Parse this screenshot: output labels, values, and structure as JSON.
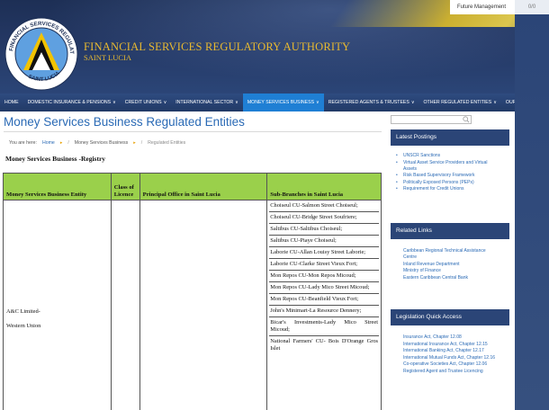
{
  "topbar": {
    "link_label": "Future Management",
    "right_label": "0/0"
  },
  "org": {
    "title": "FINANCIAL SERVICES  REGULATORY AUTHORITY",
    "subtitle": "SAINT LUCIA",
    "logo_top": "FINANCIAL SERVICES REGULATORY",
    "logo_bottom": "SAINT LUCIA"
  },
  "nav": {
    "items": [
      {
        "label": "HOME",
        "chevron": false,
        "active": false
      },
      {
        "label": "DOMESTIC INSURANCE & PENSIONS",
        "chevron": true,
        "active": false
      },
      {
        "label": "CREDIT UNIONS",
        "chevron": true,
        "active": false
      },
      {
        "label": "INTERNATIONAL SECTOR",
        "chevron": true,
        "active": false
      },
      {
        "label": "MONEY SERVICES BUSINESS",
        "chevron": true,
        "active": true
      },
      {
        "label": "REGISTERED AGENTS & TRUSTEES",
        "chevron": true,
        "active": false
      },
      {
        "label": "OTHER REGULATED ENTITIES",
        "chevron": true,
        "active": false
      },
      {
        "label": "OUR MEDIA",
        "chevron": true,
        "active": false
      }
    ],
    "chevron_glyph": "∨"
  },
  "page": {
    "title": "Money Services Business Regulated Entities",
    "breadcrumb": {
      "prefix": "You are here:",
      "home": "Home",
      "parent": "Money Services Business",
      "current": "Regulated Entities"
    },
    "section_heading": "Money Services Business -Registry"
  },
  "table": {
    "headers": {
      "entity": "Money Services Business Entity",
      "class": "Class of Licence",
      "office": "Principal Office in Saint Lucia",
      "branches": "Sub-Branches in Saint Lucia"
    },
    "entity_name": "A&C Limited-",
    "entity_name2": "Western Union",
    "branches": [
      "Choiseul CU-Salmon Street Choiseul;",
      "Choiseul CU-Bridge Street Soufriere;",
      "Saltibus CU-Saltibus Choiseul;",
      "Saltibus CU-Piaye Choiseul;",
      "Laborie CU-Allan Louisy Street Laborie;",
      "Laborie CU-Clarke Street Vieux Fort;",
      "Mon Repos CU-Mon Repos Micoud;",
      "Mon Repos CU-Lady Mico Street Micoud;",
      "Mon Repos CU-Beanfield Vieux Fort;",
      "John's Minimart-La Resource Dennery;",
      "Bicar's Investments-Lady Mico Street Micoud;",
      "National Farmers' CU- Bois D'Orange Gros Islet"
    ]
  },
  "sidebar": {
    "latest_title": "Latest Postings",
    "latest_items": [
      "UNSCR Sanctions",
      "Virtual Asset Service Providers and Virtual Assets",
      "Risk Based Supervisory Framework",
      "Politically Exposed Persons (PEPs)",
      "Requirement for Credit Unions"
    ],
    "related_title": "Related Links",
    "related_items": [
      "Caribbean Regional Technical Assistance Centre",
      "Inland Revenue Department",
      "Ministry of Finance",
      "Eastern Caribbean Central Bank"
    ],
    "legislation_title": "Legislation Quick Access",
    "legislation_items": [
      "Insurance Act, Chapter 12.08",
      "International Insurance Act, Chapter 12.15",
      "International Banking Act, Chapter 12.17",
      "International Mutual Funds Act, Chapter 12.16",
      "Co-operative Societies Act, Chapter 12.06",
      "Registered Agent and Trustee Licencing"
    ]
  },
  "colors": {
    "brand_navy": "#243864",
    "accent_gold": "#e8b930",
    "link_blue": "#2a6ab5",
    "table_header_green": "#9ad04b",
    "nav_active": "#1f7fd4"
  }
}
